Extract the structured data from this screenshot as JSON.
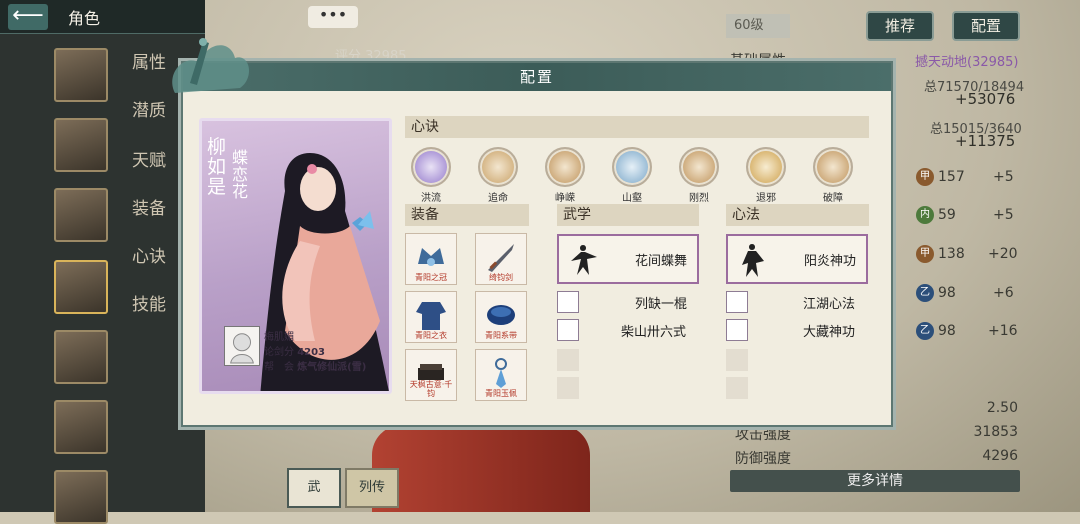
{
  "topbar": {
    "back_icon": "back-arrow-icon",
    "title": "角色"
  },
  "sidenav": [
    "属性",
    "潜质",
    "天赋",
    "装备",
    "心诀",
    "技能"
  ],
  "background": {
    "dots": "•••",
    "score": "评分 32985",
    "level": "60级",
    "recommend": "推荐",
    "config": "配置",
    "basic_attr": "基础属性",
    "title_badge": "撼天动地(32985)",
    "total1": "总71570/18494",
    "val1": "+53076",
    "total2": "总15015/3640",
    "val2": "+11375",
    "stats": [
      {
        "icon": "甲",
        "value": "157",
        "bonus": "+5"
      },
      {
        "icon": "内",
        "value": "59",
        "bonus": "+5"
      },
      {
        "icon": "甲",
        "value": "138",
        "bonus": "+20"
      },
      {
        "icon": "乙",
        "value": "98",
        "bonus": "+6"
      },
      {
        "icon": "乙",
        "value": "98",
        "bonus": "+16"
      }
    ],
    "right_val": "2.50",
    "attack_label": "攻击强度",
    "attack_val": "31853",
    "defense_label": "防御强度",
    "defense_val": "4296",
    "more": "更多详情",
    "tab1": "武",
    "tab2": "列传"
  },
  "modal": {
    "title": "配置",
    "card": {
      "name": "柳如是",
      "title": "蝶恋花",
      "user": "梅肌媚",
      "score_label": "论剑分",
      "score": "4203",
      "guild_label": "帮　会",
      "guild": "炼气修仙派(雪)"
    },
    "xinjue": {
      "header": "心诀",
      "items": [
        "洪流",
        "追命",
        "峥嵘",
        "山壑",
        "刚烈",
        "退邪",
        "破障"
      ]
    },
    "equip": {
      "header": "装备",
      "items": [
        "青阳之冠",
        "绮钧剑",
        "青阳之衣",
        "青阳系带",
        "天枫古意·千钧",
        "青阳玉佩"
      ]
    },
    "wuxue": {
      "header": "武学",
      "main": "花间蝶舞",
      "subs": [
        "列缺一棍",
        "柴山卅六式"
      ]
    },
    "xinfa": {
      "header": "心法",
      "main": "阳炎神功",
      "subs": [
        "江湖心法",
        "大藏神功"
      ]
    }
  }
}
